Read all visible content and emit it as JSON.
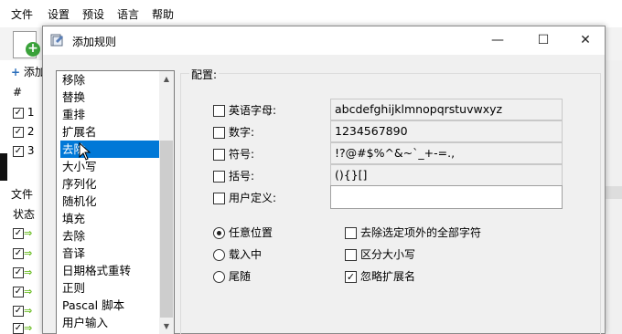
{
  "menubar": {
    "items": [
      "文件",
      "设置",
      "预设",
      "语言",
      "帮助"
    ]
  },
  "background": {
    "add_label": "添加",
    "hash_header": "#",
    "rows": [
      "1",
      "2",
      "3"
    ],
    "files_label": "文件",
    "status_header": "状态",
    "plus_glyph": "+",
    "check_glyph": "✓",
    "arrow_glyph": "⇒"
  },
  "dialog": {
    "title": "添加规则",
    "minimize_glyph": "—",
    "maximize_glyph": "☐",
    "close_glyph": "✕",
    "rules": [
      "移除",
      "替换",
      "重排",
      "扩展名",
      "去除",
      "大小写",
      "序列化",
      "随机化",
      "填充",
      "去除",
      "音译",
      "日期格式重转",
      "正则",
      "Pascal 脚本",
      "用户输入"
    ],
    "selected_rule_index": 4,
    "scroll_up_glyph": "▲",
    "scroll_down_glyph": "▼",
    "config_label": "配置:",
    "options": [
      {
        "label": "英语字母:",
        "value": "abcdefghijklmnopqrstuvwxyz",
        "checked": false
      },
      {
        "label": "数字:",
        "value": "1234567890",
        "checked": false
      },
      {
        "label": "符号:",
        "value": "!?@#$%^&~`_+-=.,",
        "checked": false
      },
      {
        "label": "括号:",
        "value": "(){}[]",
        "checked": false
      },
      {
        "label": "用户定义:",
        "value": "",
        "checked": false
      }
    ],
    "positions": [
      {
        "label": "任意位置",
        "selected": true
      },
      {
        "label": "载入中",
        "selected": false
      },
      {
        "label": "尾随",
        "selected": false
      }
    ],
    "flags": [
      {
        "label": "去除选定项外的全部字符",
        "checked": false
      },
      {
        "label": "区分大小写",
        "checked": false
      },
      {
        "label": "忽略扩展名",
        "checked": true
      }
    ],
    "check_glyph": "✓"
  }
}
